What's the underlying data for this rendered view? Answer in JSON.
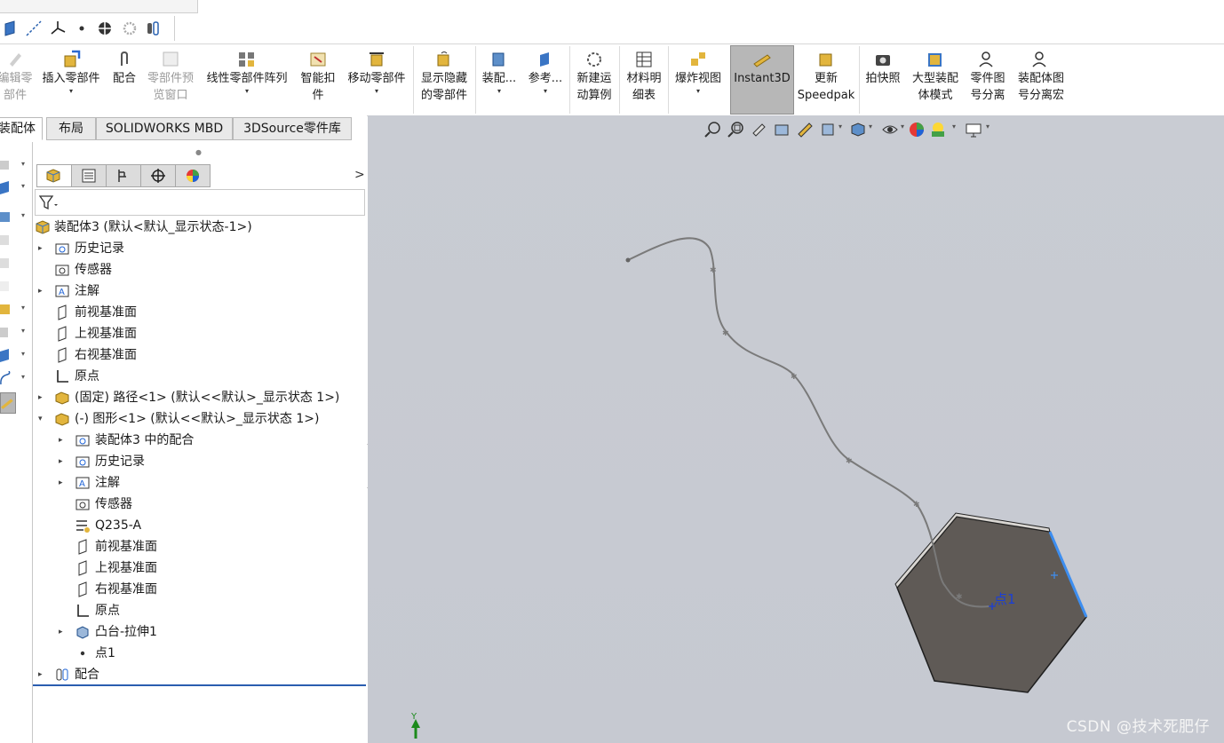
{
  "quickbar": {
    "icons": [
      "plane-icon",
      "axis-icon",
      "coordinate-system-icon",
      "point-icon",
      "mate-reference-icon",
      "gear-icon",
      "mate-icon"
    ]
  },
  "ribbon": {
    "buttons": [
      {
        "label1": "编辑零",
        "label2": "部件",
        "dim": true
      },
      {
        "label1": "插入零部件",
        "label2": "",
        "dropdown": "▾"
      },
      {
        "label1": "配合",
        "label2": ""
      },
      {
        "label1": "零部件预",
        "label2": "览窗口",
        "dim": true
      },
      {
        "label1": "线性零部件阵列",
        "label2": "",
        "dropdown": "▾"
      },
      {
        "label1": "智能扣",
        "label2": "件"
      },
      {
        "label1": "移动零部件",
        "label2": "",
        "dropdown": "▾"
      },
      {
        "label1": "显示隐藏",
        "label2": "的零部件"
      },
      {
        "label1": "装配...",
        "label2": "",
        "dropdown": "▾"
      },
      {
        "label1": "参考...",
        "label2": "",
        "dropdown": "▾"
      },
      {
        "label1": "新建运",
        "label2": "动算例"
      },
      {
        "label1": "材料明",
        "label2": "细表"
      },
      {
        "label1": "爆炸视图",
        "label2": "",
        "dropdown": "▾"
      },
      {
        "label1": "Instant3D",
        "label2": ""
      },
      {
        "label1": "更新",
        "label2": "Speedpak"
      },
      {
        "label1": "拍快照",
        "label2": ""
      },
      {
        "label1": "大型装配",
        "label2": "体模式"
      },
      {
        "label1": "零件图",
        "label2": "号分离"
      },
      {
        "label1": "装配体图",
        "label2": "号分离宏"
      }
    ]
  },
  "tabs": [
    "装配体",
    "布局",
    "SOLIDWORKS MBD",
    "3DSource零件库"
  ],
  "panel": {
    "expand_arrow": ">",
    "tree": [
      {
        "label": "装配体3  (默认<默认_显示状态-1>)",
        "arrow": "",
        "depth": 0
      },
      {
        "label": "历史记录",
        "arrow": "▸",
        "depth": 1
      },
      {
        "label": "传感器",
        "arrow": "",
        "depth": 1
      },
      {
        "label": "注解",
        "arrow": "▸",
        "depth": 1
      },
      {
        "label": "前视基准面",
        "arrow": "",
        "depth": 1
      },
      {
        "label": "上视基准面",
        "arrow": "",
        "depth": 1
      },
      {
        "label": "右视基准面",
        "arrow": "",
        "depth": 1
      },
      {
        "label": "原点",
        "arrow": "",
        "depth": 1
      },
      {
        "label": "(固定) 路径<1> (默认<<默认>_显示状态 1>)",
        "arrow": "▸",
        "depth": 1
      },
      {
        "label": "(-) 图形<1> (默认<<默认>_显示状态 1>)",
        "arrow": "▾",
        "depth": 1
      },
      {
        "label": "装配体3 中的配合",
        "arrow": "▸",
        "depth": 2
      },
      {
        "label": "历史记录",
        "arrow": "▸",
        "depth": 2
      },
      {
        "label": "注解",
        "arrow": "▸",
        "depth": 2
      },
      {
        "label": "传感器",
        "arrow": "",
        "depth": 2
      },
      {
        "label": "Q235-A",
        "arrow": "",
        "depth": 2
      },
      {
        "label": "前视基准面",
        "arrow": "",
        "depth": 2
      },
      {
        "label": "上视基准面",
        "arrow": "",
        "depth": 2
      },
      {
        "label": "右视基准面",
        "arrow": "",
        "depth": 2
      },
      {
        "label": "原点",
        "arrow": "",
        "depth": 2
      },
      {
        "label": "凸台-拉伸1",
        "arrow": "▸",
        "depth": 2
      },
      {
        "label": "点1",
        "arrow": "",
        "depth": 2
      },
      {
        "label": "配合",
        "arrow": "▸",
        "depth": 1
      }
    ]
  },
  "viewport": {
    "point_label": "点1",
    "axis_label": "Y",
    "watermark": "CSDN @技术死肥仔",
    "colors": {
      "background": "#c8cbd2",
      "solid_face": "#5f5a56",
      "edge_highlight": "#3d8ef0",
      "curve": "#7a7a7a"
    }
  }
}
